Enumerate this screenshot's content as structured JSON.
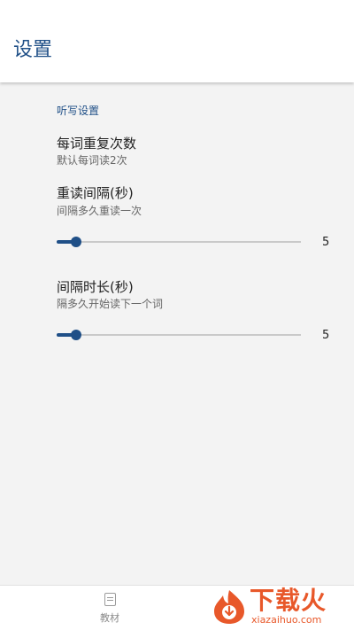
{
  "app_bar": {
    "title": "设置"
  },
  "section": {
    "header": "听写设置"
  },
  "preferences": [
    {
      "title": "每词重复次数",
      "summary": "默认每词读2次"
    },
    {
      "title": "重读间隔(秒)",
      "summary": "间隔多久重读一次",
      "slider_value": "5",
      "slider_fraction": 0.08
    },
    {
      "title": "间隔时长(秒)",
      "summary": "隔多久开始读下一个词",
      "slider_value": "5",
      "slider_fraction": 0.08
    }
  ],
  "bottom_nav": {
    "items": [
      {
        "label": "教材",
        "icon": "book-icon"
      }
    ]
  },
  "watermark": {
    "text": "下载火",
    "site": "xiazaihuo.com"
  },
  "colors": {
    "accent": "#1f4f87",
    "watermark": "#e8582a"
  }
}
